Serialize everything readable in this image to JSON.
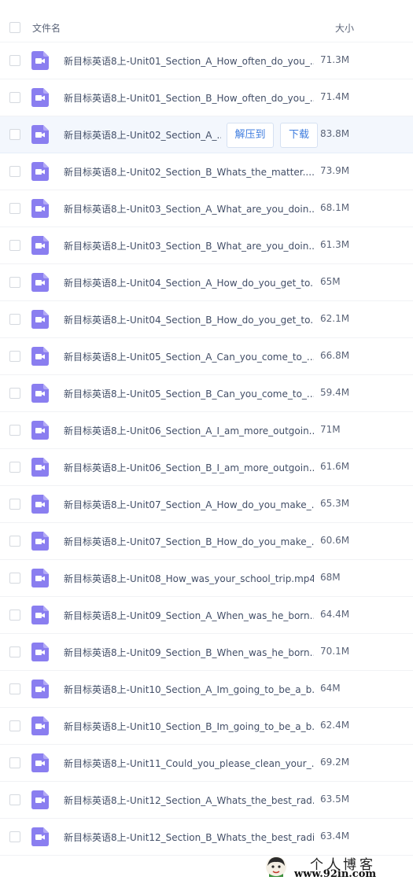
{
  "header": {
    "col_name": "文件名",
    "col_size": "大小"
  },
  "actions": {
    "extract": "解压到",
    "download": "下载"
  },
  "files": [
    {
      "name": "新目标英语8上-Unit01_Section_A_How_often_do_you_...",
      "size": "71.3M"
    },
    {
      "name": "新目标英语8上-Unit01_Section_B_How_often_do_you_...",
      "size": "71.4M"
    },
    {
      "name": "新目标英语8上-Unit02_Section_A_...",
      "size": "83.8M",
      "hovered": true
    },
    {
      "name": "新目标英语8上-Unit02_Section_B_Whats_the_matter....",
      "size": "73.9M"
    },
    {
      "name": "新目标英语8上-Unit03_Section_A_What_are_you_doin...",
      "size": "68.1M"
    },
    {
      "name": "新目标英语8上-Unit03_Section_B_What_are_you_doin...",
      "size": "61.3M"
    },
    {
      "name": "新目标英语8上-Unit04_Section_A_How_do_you_get_to...",
      "size": "65M"
    },
    {
      "name": "新目标英语8上-Unit04_Section_B_How_do_you_get_to...",
      "size": "62.1M"
    },
    {
      "name": "新目标英语8上-Unit05_Section_A_Can_you_come_to_...",
      "size": "66.8M"
    },
    {
      "name": "新目标英语8上-Unit05_Section_B_Can_you_come_to_...",
      "size": "59.4M"
    },
    {
      "name": "新目标英语8上-Unit06_Section_A_I_am_more_outgoin...",
      "size": "71M"
    },
    {
      "name": "新目标英语8上-Unit06_Section_B_I_am_more_outgoin...",
      "size": "61.6M"
    },
    {
      "name": "新目标英语8上-Unit07_Section_A_How_do_you_make_...",
      "size": "65.3M"
    },
    {
      "name": "新目标英语8上-Unit07_Section_B_How_do_you_make_...",
      "size": "60.6M"
    },
    {
      "name": "新目标英语8上-Unit08_How_was_your_school_trip.mp4",
      "size": "68M"
    },
    {
      "name": "新目标英语8上-Unit09_Section_A_When_was_he_born....",
      "size": "64.4M"
    },
    {
      "name": "新目标英语8上-Unit09_Section_B_When_was_he_born....",
      "size": "70.1M"
    },
    {
      "name": "新目标英语8上-Unit10_Section_A_Im_going_to_be_a_b...",
      "size": "64M"
    },
    {
      "name": "新目标英语8上-Unit10_Section_B_Im_going_to_be_a_b...",
      "size": "62.4M"
    },
    {
      "name": "新目标英语8上-Unit11_Could_you_please_clean_your_...",
      "size": "69.2M"
    },
    {
      "name": "新目标英语8上-Unit12_Section_A_Whats_the_best_rad...",
      "size": "63.5M"
    },
    {
      "name": "新目标英语8上-Unit12_Section_B_Whats_the_best_radi...",
      "size": "63.4M"
    }
  ],
  "icons": {
    "file_icon": "video-file-icon",
    "checkbox": "checkbox-icon"
  },
  "colors": {
    "video_icon": "#8a7ef0",
    "accent": "#3f7ddf",
    "hover_row": "#f3f7fd"
  },
  "watermark": {
    "title": "个人博客",
    "url": "www.92in.com"
  }
}
